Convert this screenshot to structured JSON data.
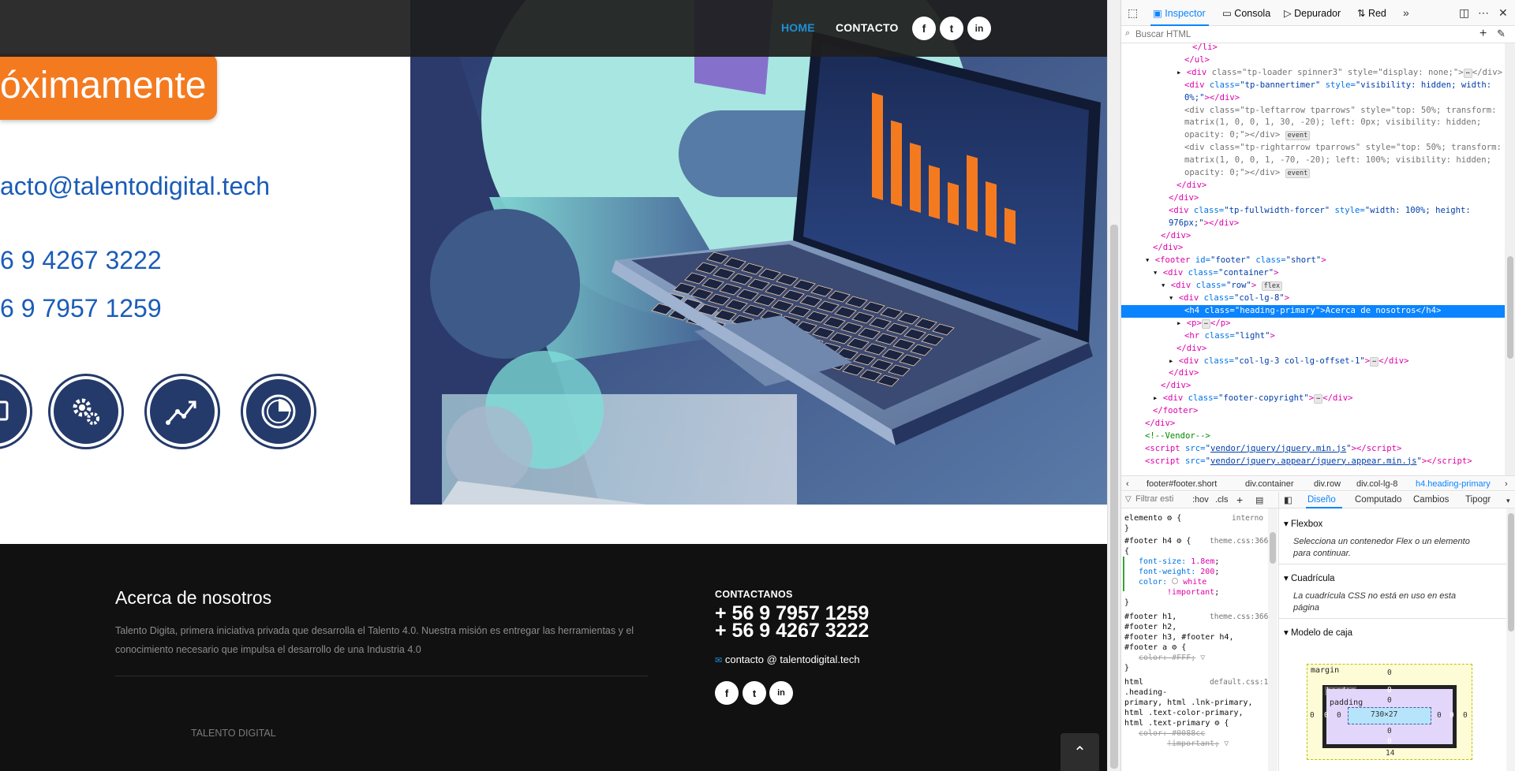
{
  "nav": {
    "home": "HOME",
    "contact": "CONTACTO",
    "social": [
      "f",
      "t",
      "in"
    ]
  },
  "hero": {
    "badge": "óximamente",
    "email": "acto@talentodigital.tech",
    "phone1": "6 9 4267 3222",
    "phone2": "6 9 7957 1259",
    "icons": [
      "monitor-icon",
      "gears-icon",
      "trend-chart-icon",
      "pie-chart-icon"
    ],
    "bars": [
      0.78,
      0.62,
      0.5,
      0.38,
      0.3,
      0.55,
      0.4,
      0.25
    ]
  },
  "footer": {
    "about_title": "Acerca de nosotros",
    "about_text": "Talento Digita, primera iniciativa privada que desarrolla el Talento 4.0. Nuestra misión es entregar las herramientas y el conocimiento necesario que impulsa el desarrollo de una Industria 4.0",
    "brand": "TALENTO DIGITAL",
    "contact_heading": "CONTACTANOS",
    "phone1": "+ 56 9 7957 1259",
    "phone2": "+ 56 9 4267 3222",
    "email": "contacto @ talentodigital.tech",
    "social": [
      "f",
      "t",
      "in"
    ],
    "back_to_top": "⌃"
  },
  "devtools": {
    "tabs": [
      "Inspector",
      "Consola",
      "Depurador",
      "Red"
    ],
    "search_placeholder": "Buscar HTML",
    "markup": [
      {
        "indent": 7,
        "html": "<span class='tg'>&lt;/li&gt;</span>"
      },
      {
        "indent": 6,
        "html": "<span class='tg'>&lt;/ul&gt;</span>"
      },
      {
        "indent": 5,
        "html": "▸ <span class='tg'>&lt;div</span> <span class='an dim'>class=</span><span class='av dim'>\"tp-loader spinner3\"</span> <span class='an dim'>style=</span><span class='av dim'>\"display: none;\"</span><span class='tg dim'>&gt;</span><span class='badge'>⋯</span><span class='tg dim'>&lt;/div&gt;</span>"
      },
      {
        "indent": 6,
        "html": "<span class='tg'>&lt;div</span> <span class='an'>class=</span><span class='av'>\"tp-bannertimer\"</span> <span class='an'>style=</span><span class='av'>\"visibility: hidden; width:</span>"
      },
      {
        "indent": 6,
        "html": "<span class='av'>0%;\"</span><span class='tg'>&gt;&lt;/div&gt;</span>"
      },
      {
        "indent": 6,
        "html": "<span class='tg dim'>&lt;div</span> <span class='an dim'>class=</span><span class='av dim'>\"tp-leftarrow tparrows\"</span> <span class='an dim'>style=</span><span class='av dim'>\"top: 50%; transform:</span>"
      },
      {
        "indent": 6,
        "html": "<span class='av dim'>matrix(1, 0, 0, 1, 30, -20); left: 0px; visibility: hidden;</span>"
      },
      {
        "indent": 6,
        "html": "<span class='av dim'>opacity: 0;\"</span><span class='tg dim'>&gt;&lt;/div&gt;</span> <span class='badge'>event</span>"
      },
      {
        "indent": 6,
        "html": "<span class='tg dim'>&lt;div</span> <span class='an dim'>class=</span><span class='av dim'>\"tp-rightarrow tparrows\"</span> <span class='an dim'>style=</span><span class='av dim'>\"top: 50%; transform:</span>"
      },
      {
        "indent": 6,
        "html": "<span class='av dim'>matrix(1, 0, 0, 1, -70, -20); left: 100%; visibility: hidden;</span>"
      },
      {
        "indent": 6,
        "html": "<span class='av dim'>opacity: 0;\"</span><span class='tg dim'>&gt;&lt;/div&gt;</span> <span class='badge'>event</span>"
      },
      {
        "indent": 5,
        "html": "<span class='tg'>&lt;/div&gt;</span>"
      },
      {
        "indent": 4,
        "html": "<span class='tg'>&lt;/div&gt;</span>"
      },
      {
        "indent": 4,
        "html": "<span class='tg'>&lt;div</span> <span class='an'>class=</span><span class='av'>\"tp-fullwidth-forcer\"</span> <span class='an'>style=</span><span class='av'>\"width: 100%; height:</span>"
      },
      {
        "indent": 4,
        "html": "<span class='av'>976px;\"</span><span class='tg'>&gt;&lt;/div&gt;</span>"
      },
      {
        "indent": 3,
        "html": "<span class='tg'>&lt;/div&gt;</span>"
      },
      {
        "indent": 2,
        "html": "<span class='tg'>&lt;/div&gt;</span>"
      },
      {
        "indent": 1,
        "html": "▾ <span class='tg'>&lt;footer</span> <span class='an'>id=</span><span class='av'>\"footer\"</span> <span class='an'>class=</span><span class='av'>\"short\"</span><span class='tg'>&gt;</span>"
      },
      {
        "indent": 2,
        "html": "▾ <span class='tg'>&lt;div</span> <span class='an'>class=</span><span class='av'>\"container\"</span><span class='tg'>&gt;</span>"
      },
      {
        "indent": 3,
        "html": "▾ <span class='tg'>&lt;div</span> <span class='an'>class=</span><span class='av'>\"row\"</span><span class='tg'>&gt;</span> <span class='badge'>flex</span>"
      },
      {
        "indent": 4,
        "html": "▾ <span class='tg'>&lt;div</span> <span class='an'>class=</span><span class='av'>\"col-lg-8\"</span><span class='tg'>&gt;</span>"
      },
      {
        "indent": 6,
        "html": "<span class='tg'>&lt;h4</span> <span class='an'>class=</span><span class='av'>\"heading-primary\"</span><span class='tg'>&gt;</span>Acerca de nosotros<span class='tg'>&lt;/h4&gt;</span>",
        "selected": true
      },
      {
        "indent": 5,
        "html": "▸ <span class='tg'>&lt;p&gt;</span><span class='badge'>⋯</span><span class='tg'>&lt;/p&gt;</span>"
      },
      {
        "indent": 6,
        "html": "<span class='tg'>&lt;hr</span> <span class='an'>class=</span><span class='av'>\"light\"</span><span class='tg'>&gt;</span>"
      },
      {
        "indent": 5,
        "html": "<span class='tg'>&lt;/div&gt;</span>"
      },
      {
        "indent": 4,
        "html": "▸ <span class='tg'>&lt;div</span> <span class='an'>class=</span><span class='av'>\"col-lg-3 col-lg-offset-1\"</span><span class='tg'>&gt;</span><span class='badge'>⋯</span><span class='tg'>&lt;/div&gt;</span>"
      },
      {
        "indent": 4,
        "html": "<span class='tg'>&lt;/div&gt;</span>"
      },
      {
        "indent": 3,
        "html": "<span class='tg'>&lt;/div&gt;</span>"
      },
      {
        "indent": 2,
        "html": "▸ <span class='tg'>&lt;div</span> <span class='an'>class=</span><span class='av'>\"footer-copyright\"</span><span class='tg'>&gt;</span><span class='badge'>⋯</span><span class='tg'>&lt;/div&gt;</span>"
      },
      {
        "indent": 2,
        "html": "<span class='tg'>&lt;/footer&gt;</span>"
      },
      {
        "indent": 1,
        "html": "<span class='tg'>&lt;/div&gt;</span>"
      },
      {
        "indent": 1,
        "html": "<span class='cm'>&lt;!--Vendor--&gt;</span>"
      },
      {
        "indent": 1,
        "html": "<span class='tg'>&lt;script</span> <span class='an'>src=</span><span class='av'>\"<u>vendor/jquery/jquery.min.js</u>\"</span><span class='tg'>&gt;&lt;/script&gt;</span>"
      },
      {
        "indent": 1,
        "html": "<span class='tg'>&lt;script</span> <span class='an'>src=</span><span class='av'>\"<u>vendor/jquery.appear/jquery.appear.min.js</u>\"</span><span class='tg'>&gt;&lt;/script&gt;</span>"
      }
    ],
    "breadcrumbs": [
      "footer#footer.short",
      "div.container",
      "div.row",
      "div.col-lg-8",
      "h4.heading-primary"
    ],
    "rules_filter_placeholder": "Filtrar esti",
    "rules_buttons": [
      ":hov",
      ".cls",
      "+"
    ],
    "layout_tabs": [
      "Diseño",
      "Computado",
      "Cambios",
      "Tipogr"
    ],
    "flexbox_title": "Flexbox",
    "flexbox_text": "Selecciona un contenedor Flex o un elemento para continuar.",
    "grid_title": "Cuadrícula",
    "grid_text": "La cuadrícula CSS no está en uso en esta página",
    "boxmodel_title": "Modelo de caja",
    "boxmodel": {
      "margin": "margin",
      "border": "border",
      "padding": "padding",
      "content": "730×27",
      "margin_bottom": "14",
      "zero": "0"
    }
  }
}
